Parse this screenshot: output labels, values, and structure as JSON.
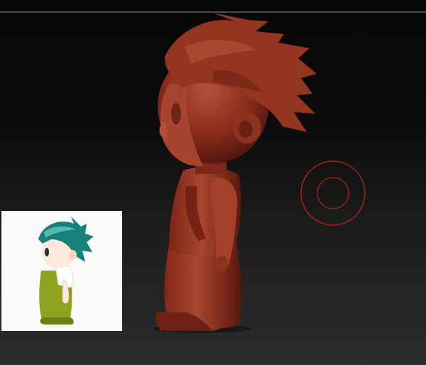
{
  "app": {
    "name": "",
    "mode": "sculpt"
  },
  "viewport": {
    "background_top": "#060606",
    "background_bottom": "#2c2c2c",
    "model_color": "#8a2c1d",
    "model_highlight": "#b4523a",
    "model_shadow": "#4a130c"
  },
  "brush_cursor": {
    "color": "#b02020",
    "icon": "brush-circle-icon"
  },
  "reference_image": {
    "icon": "reference-character-image",
    "hair_color": "#17807a",
    "overalls_color": "#8ea21e",
    "shirt_color": "#ffffff",
    "skin_color": "#fde8dc"
  }
}
